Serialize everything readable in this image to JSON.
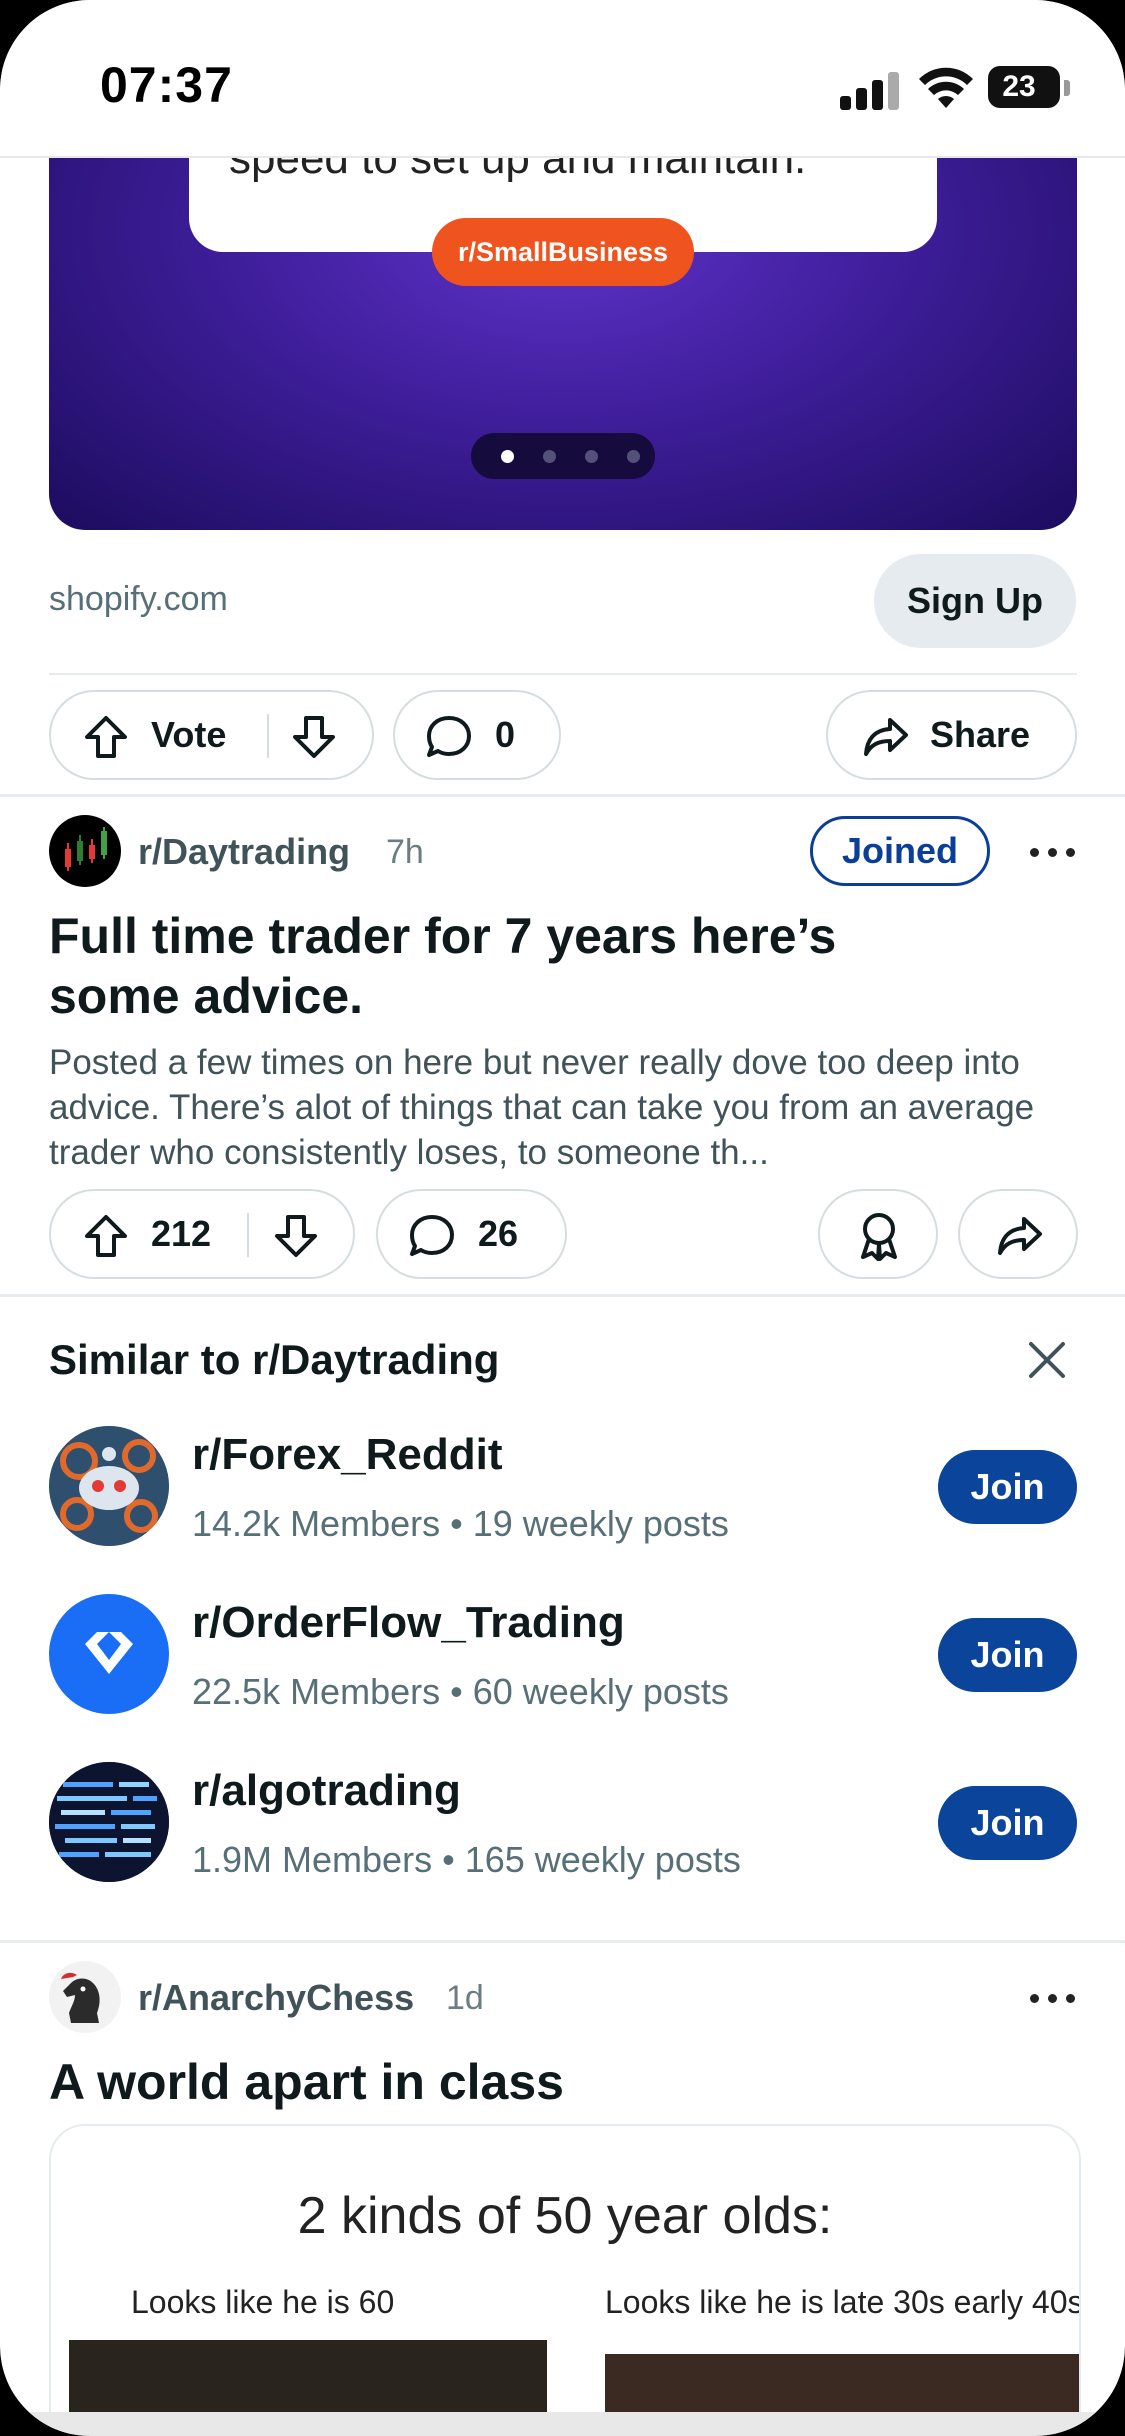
{
  "status": {
    "time": "07:37",
    "battery": "23"
  },
  "ad": {
    "card_text": "speed to set up and maintain.",
    "subreddit_pill": "r/SmallBusiness",
    "domain": "shopify.com",
    "cta": "Sign Up",
    "vote_label": "Vote",
    "comments": "0",
    "share_label": "Share"
  },
  "post1": {
    "subreddit": "r/Daytrading",
    "age": "7h",
    "joined_label": "Joined",
    "title_line1": "Full time trader for 7 years here’s",
    "title_line2": "some advice.",
    "body": "Posted a few times on here but never really dove too deep into advice. There’s alot of things that can take you from an average trader who consistently loses, to someone th...",
    "votes": "212",
    "comments": "26"
  },
  "similar": {
    "heading": "Similar to r/Daytrading",
    "join_label": "Join",
    "items": [
      {
        "name": "r/Forex_Reddit",
        "members": "14.2k Members",
        "posts": "19 weekly posts"
      },
      {
        "name": "r/OrderFlow_Trading",
        "members": "22.5k Members",
        "posts": "60 weekly posts"
      },
      {
        "name": "r/algotrading",
        "members": "1.9M Members",
        "posts": "165 weekly posts"
      }
    ]
  },
  "post2": {
    "subreddit": "r/AnarchyChess",
    "age": "1d",
    "title": "A world apart in class",
    "meme_title": "2 kinds of 50 year olds:",
    "caption_left": "Looks like he is 60",
    "caption_right": "Looks like he is late 30s early 40s"
  },
  "colors": {
    "join_blue": "#0a449b",
    "ad_orange": "#f0541e",
    "banner_purple": "#3f1e9b"
  }
}
